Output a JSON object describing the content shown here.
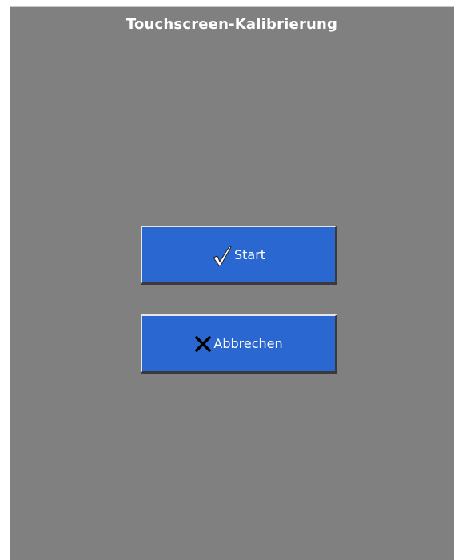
{
  "window": {
    "title": "Touchscreen-Kalibrierung"
  },
  "buttons": {
    "start_label": "Start",
    "cancel_label": "Abbrechen"
  },
  "colors": {
    "background": "#808080",
    "button": "#2b67d0",
    "text": "#ffffff"
  },
  "icons": {
    "start": "checkmark-icon",
    "cancel": "cross-icon"
  }
}
